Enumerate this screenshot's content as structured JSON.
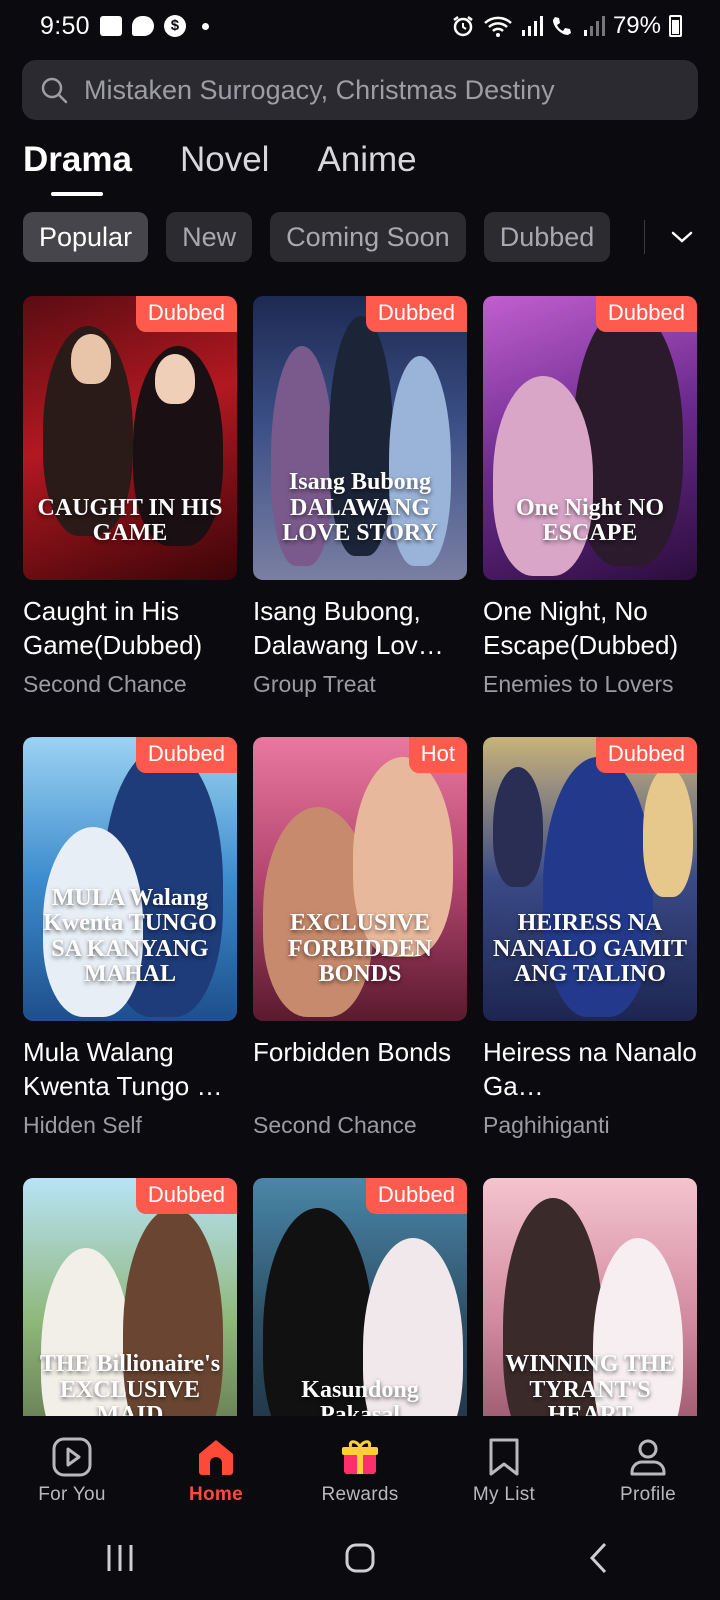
{
  "status_bar": {
    "time": "9:50",
    "battery": "79%"
  },
  "search": {
    "placeholder": "Mistaken Surrogacy, Christmas Destiny"
  },
  "main_tabs": [
    "Drama",
    "Novel",
    "Anime"
  ],
  "filters": [
    "Popular",
    "New",
    "Coming Soon",
    "Dubbed"
  ],
  "cards": [
    {
      "poster_title": "CAUGHT IN HIS GAME",
      "badge": "Dubbed",
      "title": "Caught in His Game(Dubbed)",
      "genre": "Second Chance"
    },
    {
      "poster_title": "Isang Bubong DALAWANG LOVE STORY",
      "badge": "Dubbed",
      "title": "Isang Bubong, Dalawang Lov…",
      "genre": "Group Treat"
    },
    {
      "poster_title": "One Night NO ESCAPE",
      "badge": "Dubbed",
      "title": "One Night, No Escape(Dubbed)",
      "genre": "Enemies to Lovers"
    },
    {
      "poster_title": "MULA Walang Kwenta TUNGO SA KANYANG MAHAL",
      "badge": "Dubbed",
      "title": "Mula Walang Kwenta Tungo …",
      "genre": "Hidden Self"
    },
    {
      "poster_title": "EXCLUSIVE FORBIDDEN BONDS",
      "badge": "Hot",
      "title": "Forbidden Bonds",
      "genre": "Second Chance"
    },
    {
      "poster_title": "HEIRESS NA NANALO GAMIT ANG TALINO",
      "badge": "Dubbed",
      "title": "Heiress na Nanalo Ga…",
      "genre": "Paghihiganti"
    },
    {
      "poster_title": "THE Billionaire's EXCLUSIVE MAID",
      "badge": "Dubbed",
      "title": "",
      "genre": ""
    },
    {
      "poster_title": "Kasundong Pakasal",
      "badge": "Dubbed",
      "title": "",
      "genre": ""
    },
    {
      "poster_title": "WINNING THE TYRANT'S HEART",
      "badge": "",
      "title": "",
      "genre": ""
    }
  ],
  "bottom_nav": [
    {
      "label": "For You",
      "icon": "play-square-icon"
    },
    {
      "label": "Home",
      "icon": "home-icon"
    },
    {
      "label": "Rewards",
      "icon": "gift-icon"
    },
    {
      "label": "My List",
      "icon": "bookmark-icon"
    },
    {
      "label": "Profile",
      "icon": "person-icon"
    }
  ],
  "colors": {
    "accent": "#ff4a3a",
    "badge": "#ff5a4e",
    "background": "#0b0a0f"
  }
}
